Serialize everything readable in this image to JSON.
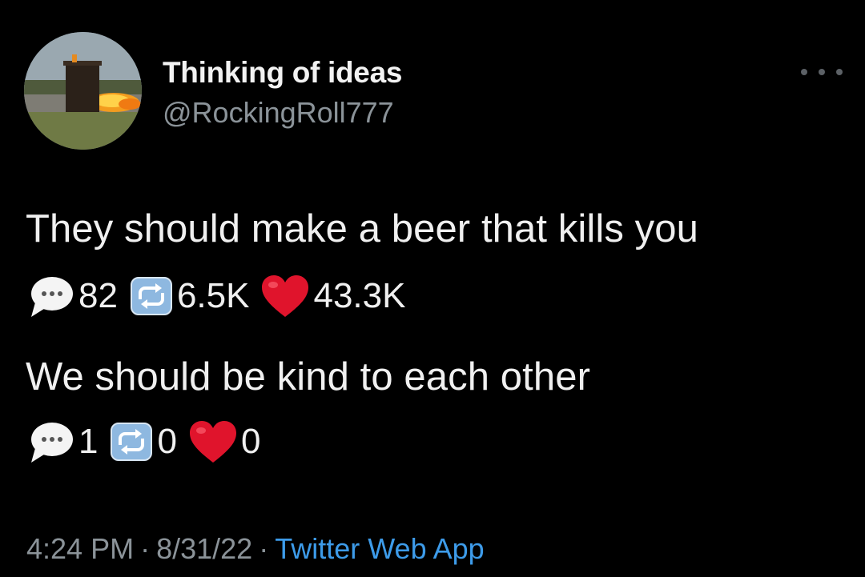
{
  "author": {
    "display_name": "Thinking of ideas",
    "handle": "@RockingRoll777",
    "avatar_icon": "outhouse-explosion-avatar"
  },
  "more_icon": "more-dots-icon",
  "items": [
    {
      "text": "They should make a beer that kills you",
      "replies": "82",
      "retweets": "6.5K",
      "likes": "43.3K"
    },
    {
      "text": "We should be kind to each other",
      "replies": "1",
      "retweets": "0",
      "likes": "0"
    }
  ],
  "icons": {
    "reply": "speech-bubble-icon",
    "retweet": "repeat-icon",
    "like": "red-heart-icon"
  },
  "footer": {
    "time": "4:24 PM",
    "separator": "·",
    "date": "8/31/22",
    "source": "Twitter Web App"
  },
  "colors": {
    "background": "#000000",
    "primary_text": "#e7e9ea",
    "secondary_text": "#8b9399",
    "link": "#3d9be9",
    "heart": "#e0142c",
    "retweet_box": "#8eb8e0"
  }
}
